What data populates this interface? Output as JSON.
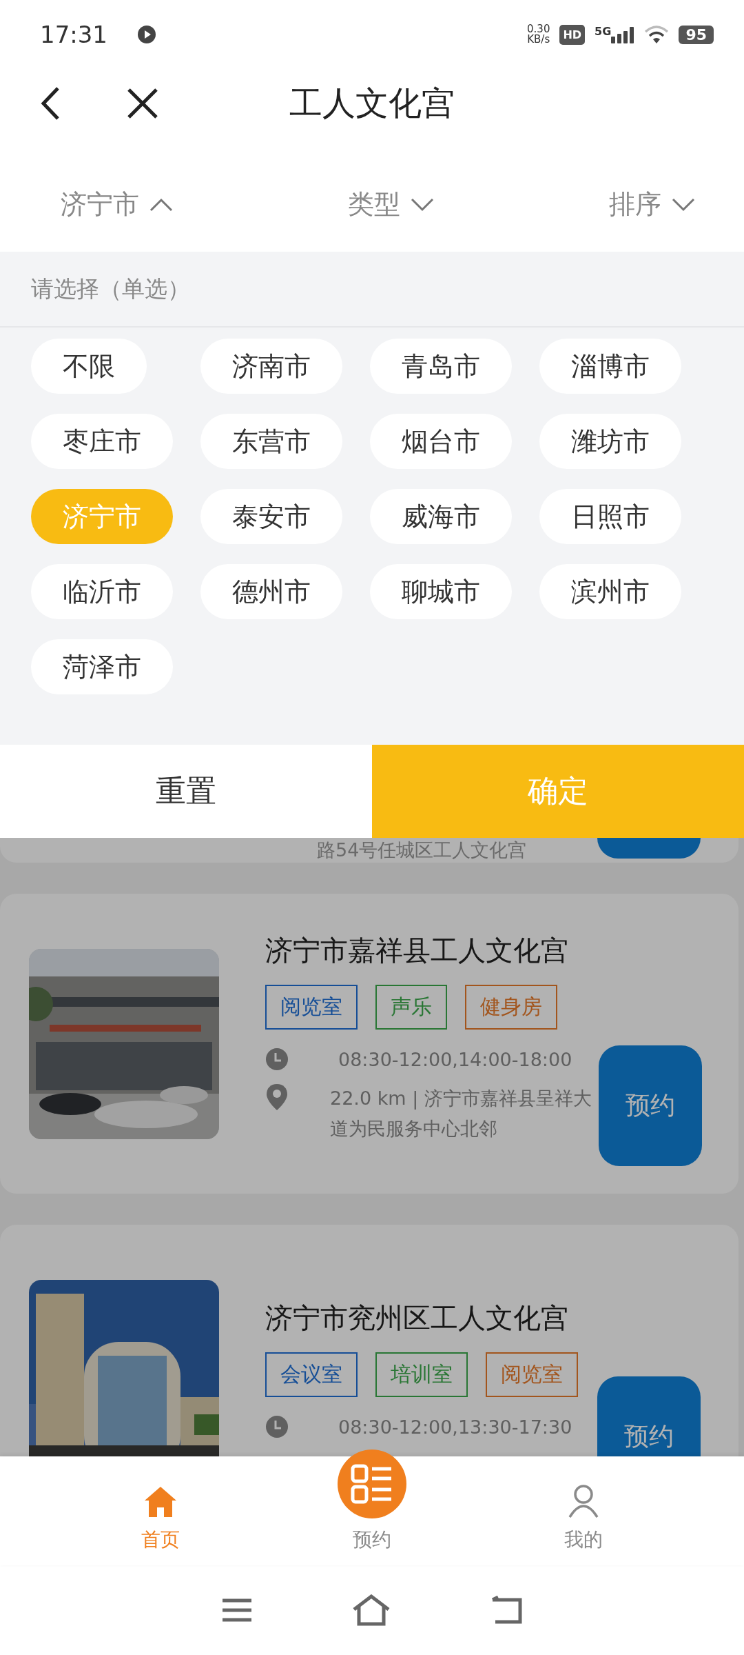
{
  "status_bar": {
    "time": "17:31",
    "net_speed_value": "0.30",
    "net_speed_unit": "KB/s",
    "hd": "HD",
    "network": "5G",
    "battery": "95"
  },
  "header": {
    "title": "工人文化宫"
  },
  "filters": [
    {
      "label": "济宁市",
      "expanded": true
    },
    {
      "label": "类型",
      "expanded": false
    },
    {
      "label": "排序",
      "expanded": false
    }
  ],
  "picker": {
    "hint": "请选择（单选）",
    "options": [
      {
        "label": "不限",
        "selected": false
      },
      {
        "label": "济南市",
        "selected": false
      },
      {
        "label": "青岛市",
        "selected": false
      },
      {
        "label": "淄博市",
        "selected": false
      },
      {
        "label": "枣庄市",
        "selected": false
      },
      {
        "label": "东营市",
        "selected": false
      },
      {
        "label": "烟台市",
        "selected": false
      },
      {
        "label": "潍坊市",
        "selected": false
      },
      {
        "label": "济宁市",
        "selected": true
      },
      {
        "label": "泰安市",
        "selected": false
      },
      {
        "label": "威海市",
        "selected": false
      },
      {
        "label": "日照市",
        "selected": false
      },
      {
        "label": "临沂市",
        "selected": false
      },
      {
        "label": "德州市",
        "selected": false
      },
      {
        "label": "聊城市",
        "selected": false
      },
      {
        "label": "滨州市",
        "selected": false
      },
      {
        "label": "菏泽市",
        "selected": false
      }
    ]
  },
  "actions": {
    "reset": "重置",
    "confirm": "确定"
  },
  "partial_card": {
    "address": "路54号任城区工人文化宫"
  },
  "venues": [
    {
      "kind": "picture",
      "title": "济宁市嘉祥县工人文化宫",
      "tags": [
        {
          "label": "阅览室",
          "color": "#164e96"
        },
        {
          "label": "声乐",
          "color": "#297634"
        },
        {
          "label": "健身房",
          "color": "#a2551d"
        }
      ],
      "hours": "08:30-12:00,14:00-18:00",
      "address": "22.0 km | 济宁市嘉祥县呈祥大道为民服务中心北邻",
      "book": "预约"
    },
    {
      "kind": "picture",
      "title": "济宁市兖州区工人文化宫",
      "tags": [
        {
          "label": "会议室",
          "color": "#164e96"
        },
        {
          "label": "培训室",
          "color": "#297634"
        },
        {
          "label": "阅览室",
          "color": "#a2551d"
        }
      ],
      "hours": "08:30-12:00,13:30-17:30",
      "book": "预约"
    }
  ],
  "bottom_nav": [
    {
      "kind": "home",
      "label": "首页",
      "selected": true
    },
    {
      "kind": "booking",
      "label": "预约",
      "selected": false
    },
    {
      "kind": "profile",
      "label": "我的",
      "selected": false
    }
  ]
}
